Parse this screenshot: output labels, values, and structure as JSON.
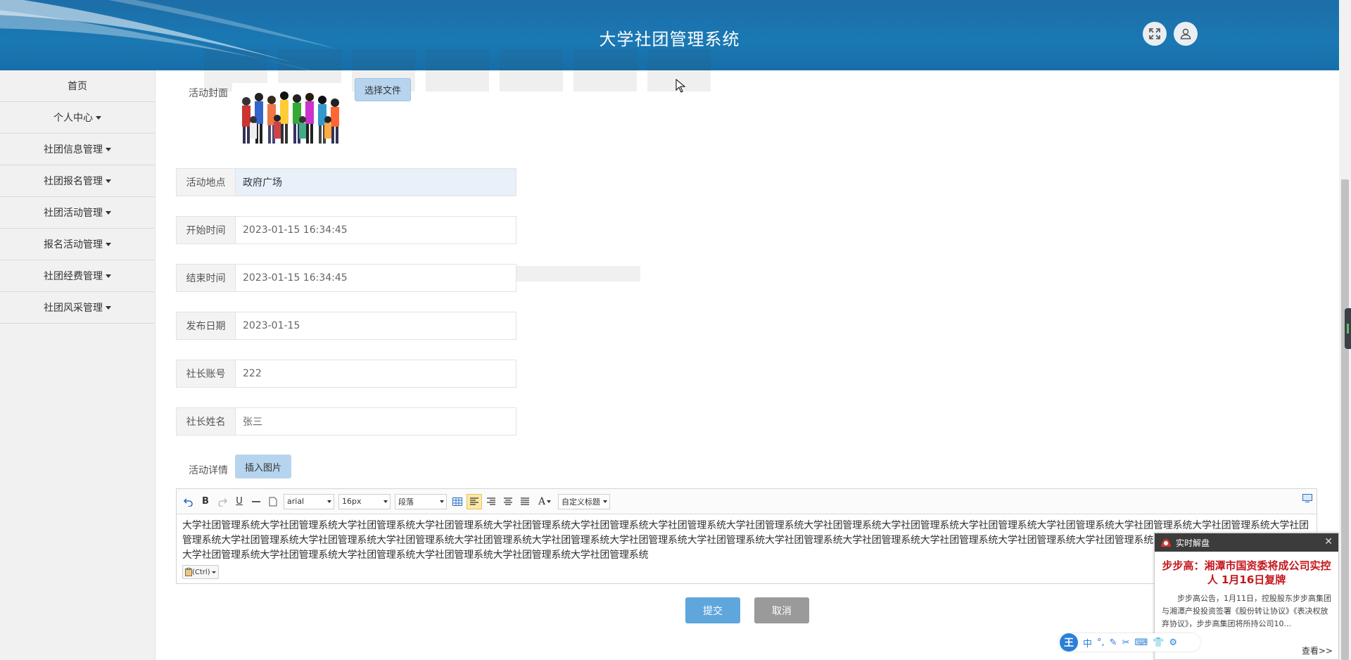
{
  "header": {
    "title": "大学社团管理系统",
    "expand_icon": "fullscreen-icon",
    "user_icon": "user-icon",
    "color": "#1a78b3"
  },
  "sidebar": {
    "items": [
      {
        "label": "首页",
        "caret": false
      },
      {
        "label": "个人中心",
        "caret": true
      },
      {
        "label": "社团信息管理",
        "caret": true
      },
      {
        "label": "社团报名管理",
        "caret": true
      },
      {
        "label": "社团活动管理",
        "caret": true
      },
      {
        "label": "报名活动管理",
        "caret": true
      },
      {
        "label": "社团经费管理",
        "caret": true
      },
      {
        "label": "社团风采管理",
        "caret": true
      }
    ]
  },
  "form": {
    "cover_label": "活动封面",
    "choose_file": "选择文件",
    "location": {
      "label": "活动地点",
      "value": "政府广场"
    },
    "start_time": {
      "label": "开始时间",
      "value": "2023-01-15 16:34:45"
    },
    "end_time": {
      "label": "结束时间",
      "value": "2023-01-15 16:34:45"
    },
    "publish_date": {
      "label": "发布日期",
      "value": "2023-01-15"
    },
    "president_account": {
      "label": "社长账号",
      "value": "222"
    },
    "president_name": {
      "label": "社长姓名",
      "value": "张三"
    },
    "detail_label": "活动详情",
    "insert_image": "插入图片",
    "submit": "提交",
    "cancel": "取消"
  },
  "editor": {
    "font_family": "arial",
    "font_size": "16px",
    "paragraph": "段落",
    "custom_heading": "自定义标题",
    "paste_hint": "(Ctrl)",
    "content": "大学社团管理系统大学社团管理系统大学社团管理系统大学社团管理系统大学社团管理系统大学社团管理系统大学社团管理系统大学社团管理系统大学社团管理系统大学社团管理系统大学社团管理系统大学社团管理系统大学社团管理系统大学社团管理系统大学社团管理系统大学社团管理系统大学社团管理系统大学社团管理系统大学社团管理系统大学社团管理系统大学社团管理系统大学社团管理系统大学社团管理系统大学社团管理系统大学社团管理系统大学社团管理系统大学社团管理系统大学社团管理系统大学社团管理系统大学社团管理系统大学社团管理系统大学社团管理系统大学社团管理系统大学社团管理系统大学社团管理系统"
  },
  "popup": {
    "header": "实时解盘",
    "title": "步步高：湘潭市国资委将成公司实控人 1月16日复牌",
    "body": "步步高公告，1月11日，控股股东步步高集团与湘潭产投投资签署《股份转让协议》《表决权放弃协议》，步步高集团将所持公司10...",
    "more": "查看>>"
  },
  "ime": {
    "logo": "王",
    "mode": "中"
  }
}
